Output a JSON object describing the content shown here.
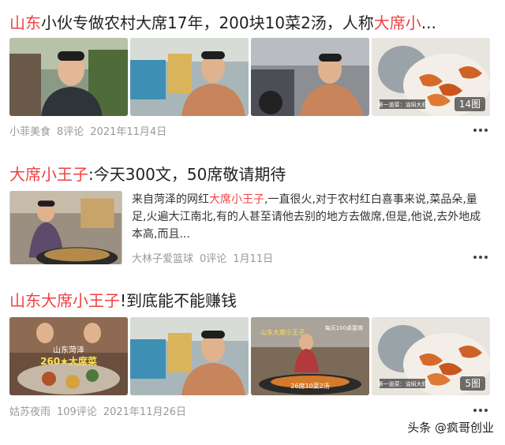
{
  "cards": [
    {
      "title_parts": [
        {
          "text": "山东",
          "hl": true
        },
        {
          "text": "小伙专做农村大席17年，200块10菜2汤，人称",
          "hl": false
        },
        {
          "text": "大席小",
          "hl": true
        },
        {
          "text": "...",
          "hl": false
        }
      ],
      "thumb_badge": "14图",
      "meta": {
        "source": "小菲美食",
        "comments": "8评论",
        "date": "2021年11月4日"
      }
    },
    {
      "title_parts": [
        {
          "text": "大席小王子",
          "hl": true
        },
        {
          "text": ":今天300文，50席敬请期待",
          "hl": false
        }
      ],
      "summary_parts": [
        {
          "text": "来自菏泽的网红",
          "hl": false
        },
        {
          "text": "大席小王子",
          "hl": true
        },
        {
          "text": ",一直很火,对于农村红白喜事来说,菜品朵,量足,火遍大江南北,有的人甚至请他去别的地方去做席,但是,他说,去外地成本高,而且...",
          "hl": false
        }
      ],
      "meta": {
        "source": "大林子爱篮球",
        "comments": "0评论",
        "date": "1月11日"
      }
    },
    {
      "title_parts": [
        {
          "text": "山东大席小王子",
          "hl": true
        },
        {
          "text": "!到底能不能赚钱",
          "hl": false
        }
      ],
      "thumb_texts": {
        "t1_line1": "山东菏泽",
        "t1_line2": "260★大席菜",
        "t3_top": "山东大席小王子",
        "t3_side": "每天100桌宴席",
        "t3_bottom": "26席10菜2汤",
        "t4_caption": "第一道菜：油焖大虾"
      },
      "thumb_badge": "5图",
      "meta": {
        "source": "姑苏夜雨",
        "comments": "109评论",
        "date": "2021年11月26日"
      }
    }
  ],
  "card1_caption": "第一道菜：油焖大虾",
  "watermark": "头条 @疯哥创业",
  "colors": {
    "highlight": "#f04142",
    "meta": "#999999",
    "text": "#222222"
  }
}
